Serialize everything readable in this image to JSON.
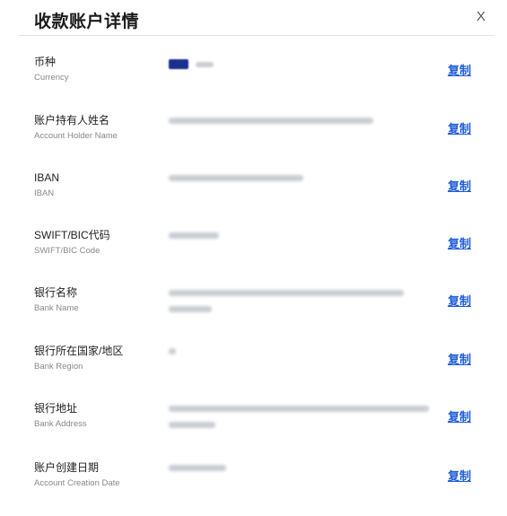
{
  "dialog": {
    "title": "收款账户详情",
    "close_label": "X",
    "copy_label": "复制"
  },
  "fields": [
    {
      "label_cn": "币种",
      "label_en": "Currency"
    },
    {
      "label_cn": "账户持有人姓名",
      "label_en": "Account Holder Name"
    },
    {
      "label_cn": "IBAN",
      "label_en": "IBAN"
    },
    {
      "label_cn": "SWIFT/BIC代码",
      "label_en": "SWIFT/BIC Code"
    },
    {
      "label_cn": "银行名称",
      "label_en": "Bank Name"
    },
    {
      "label_cn": "银行所在国家/地区",
      "label_en": "Bank Region"
    },
    {
      "label_cn": "银行地址",
      "label_en": "Bank Address"
    },
    {
      "label_cn": "账户创建日期",
      "label_en": "Account Creation Date"
    }
  ],
  "colors": {
    "link": "#1f5dd6",
    "flag": "#1c2f8f"
  }
}
